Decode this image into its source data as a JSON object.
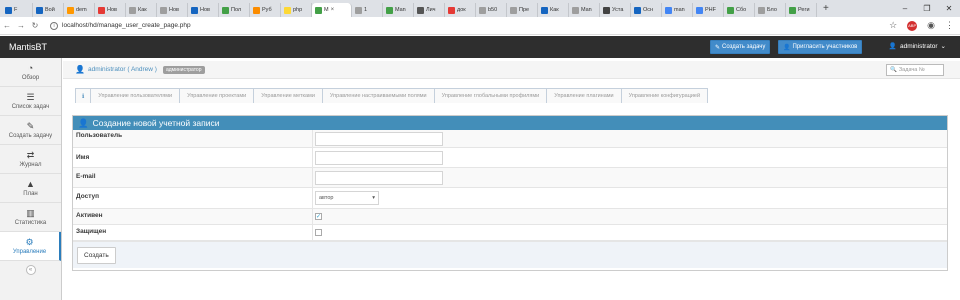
{
  "browser": {
    "tabs": [
      {
        "label": "F",
        "color": "#1565c0"
      },
      {
        "label": "Вой",
        "color": "#1565c0"
      },
      {
        "label": "dem",
        "color": "#ff9800"
      },
      {
        "label": "Нов",
        "color": "#e53935"
      },
      {
        "label": "Как",
        "color": "#9e9e9e"
      },
      {
        "label": "Нов",
        "color": "#9e9e9e"
      },
      {
        "label": "Нов",
        "color": "#1565c0"
      },
      {
        "label": "Пол",
        "color": "#43a047"
      },
      {
        "label": "Руб",
        "color": "#fb8c00"
      },
      {
        "label": "php",
        "color": "#fdd835"
      },
      {
        "label": "M",
        "color": "#43a047"
      },
      {
        "label": "1",
        "color": "#9e9e9e"
      },
      {
        "label": "Man",
        "color": "#43a047"
      },
      {
        "label": "Лич",
        "color": "#555555"
      },
      {
        "label": "док",
        "color": "#e53935"
      },
      {
        "label": "b50",
        "color": "#9e9e9e"
      },
      {
        "label": "Пре",
        "color": "#9e9e9e"
      },
      {
        "label": "Как",
        "color": "#1565c0"
      },
      {
        "label": "Man",
        "color": "#9e9e9e"
      },
      {
        "label": "Уста",
        "color": "#424242"
      },
      {
        "label": "Осн",
        "color": "#1565c0"
      },
      {
        "label": "man",
        "color": "#4285f4"
      },
      {
        "label": "PHF",
        "color": "#4285f4"
      },
      {
        "label": "Сбо",
        "color": "#43a047"
      },
      {
        "label": "Бло",
        "color": "#9e9e9e"
      },
      {
        "label": "Реги",
        "color": "#43a047"
      }
    ],
    "active_tab_index": 10,
    "url": "localhost/hd/manage_user_create_page.php"
  },
  "navbar": {
    "brand": "MantisBT",
    "create_issue": "Создать задачу",
    "invite_users": "Пригласить участников",
    "user": "administrator"
  },
  "sidebar": {
    "items": [
      {
        "label": "Обзор",
        "icon": "tachometer-icon",
        "glyph": "◔"
      },
      {
        "label": "Список задач",
        "icon": "list-icon",
        "glyph": "☰"
      },
      {
        "label": "Создать задачу",
        "icon": "edit-icon",
        "glyph": "✎"
      },
      {
        "label": "Журнал",
        "icon": "retweet-icon",
        "glyph": "⇄"
      },
      {
        "label": "План",
        "icon": "road-icon",
        "glyph": "▲"
      },
      {
        "label": "Статистика",
        "icon": "bar-chart-icon",
        "glyph": "▥"
      },
      {
        "label": "Управление",
        "icon": "gears-icon",
        "glyph": "⚙"
      }
    ],
    "active_index": 6
  },
  "breadcrumb": {
    "user": "administrator ( Andrew )",
    "role": "администратор",
    "search_placeholder": "Задача №"
  },
  "tabs": [
    "Управление пользователями",
    "Управление проектами",
    "Управление метками",
    "Управление настраиваемыми полями",
    "Управление глобальными профилями",
    "Управление плагинами",
    "Управление конфигурацией"
  ],
  "form": {
    "title": "Создание новой учетной записи",
    "username_label": "Пользователь",
    "realname_label": "Имя",
    "email_label": "E-mail",
    "access_label": "Доступ",
    "access_value": "автор",
    "enabled_label": "Активен",
    "enabled_checked": true,
    "protected_label": "Защищен",
    "protected_checked": false,
    "submit_label": "Создать"
  },
  "colors": {
    "accent": "#438eb9",
    "navbar": "#2e2e2e",
    "button": "#428bca"
  }
}
